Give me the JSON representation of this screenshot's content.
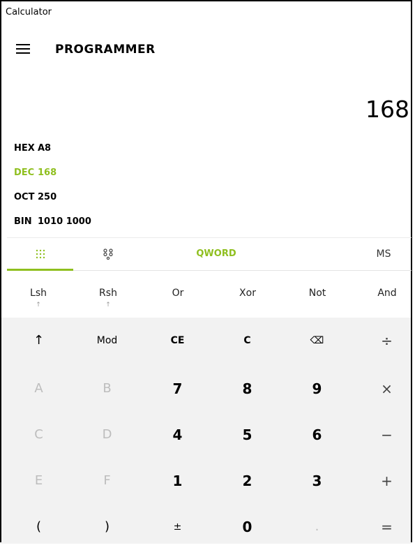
{
  "window": {
    "title": "Calculator"
  },
  "header": {
    "mode": "PROGRAMMER"
  },
  "display": {
    "value": "168"
  },
  "radix": [
    {
      "label": "HEX",
      "value": "A8",
      "active": false
    },
    {
      "label": "DEC",
      "value": "168",
      "active": true
    },
    {
      "label": "OCT",
      "value": "250",
      "active": false
    },
    {
      "label": "BIN",
      "value": "1010 1000",
      "active": false
    }
  ],
  "tabs": {
    "keypad_icon": "keypad-icon",
    "bits_icon": "bit-toggle-icon",
    "word_size": "QWORD",
    "memory": "MS"
  },
  "bit_ops": [
    {
      "label": "Lsh",
      "sub": "↑"
    },
    {
      "label": "Rsh",
      "sub": "↑"
    },
    {
      "label": "Or",
      "sub": ""
    },
    {
      "label": "Xor",
      "sub": ""
    },
    {
      "label": "Not",
      "sub": ""
    },
    {
      "label": "And",
      "sub": ""
    }
  ],
  "keys": {
    "shift": "↑",
    "mod": "Mod",
    "ce": "CE",
    "c": "C",
    "backspace": "⌫",
    "divide": "÷",
    "a": "A",
    "b": "B",
    "seven": "7",
    "eight": "8",
    "nine": "9",
    "multiply": "×",
    "c_hex": "C",
    "d": "D",
    "four": "4",
    "five": "5",
    "six": "6",
    "minus": "−",
    "e": "E",
    "f": "F",
    "one": "1",
    "two": "2",
    "three": "3",
    "plus": "+",
    "lparen": "(",
    "rparen": ")",
    "negate": "±",
    "zero": "0",
    "decimal": ".",
    "equals": "="
  }
}
